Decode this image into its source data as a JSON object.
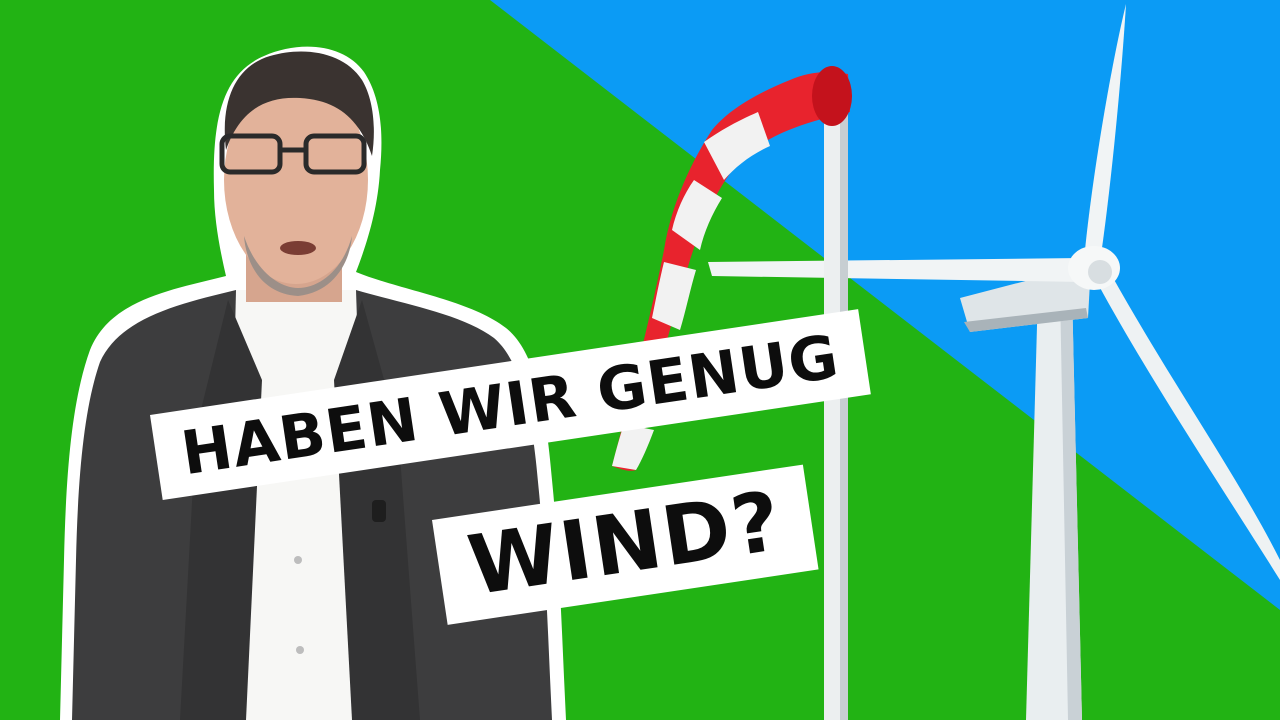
{
  "colors": {
    "green": "#22b314",
    "blue": "#0b9bf5",
    "caption_bg": "#ffffff",
    "caption_text": "#0d0d0d",
    "windsock_red": "#e8232d",
    "windsock_white": "#f2f2f2",
    "turbine_white": "#f4f6f7"
  },
  "caption": {
    "line1": "HABEN WIR GENUG",
    "line2": "WIND?"
  }
}
